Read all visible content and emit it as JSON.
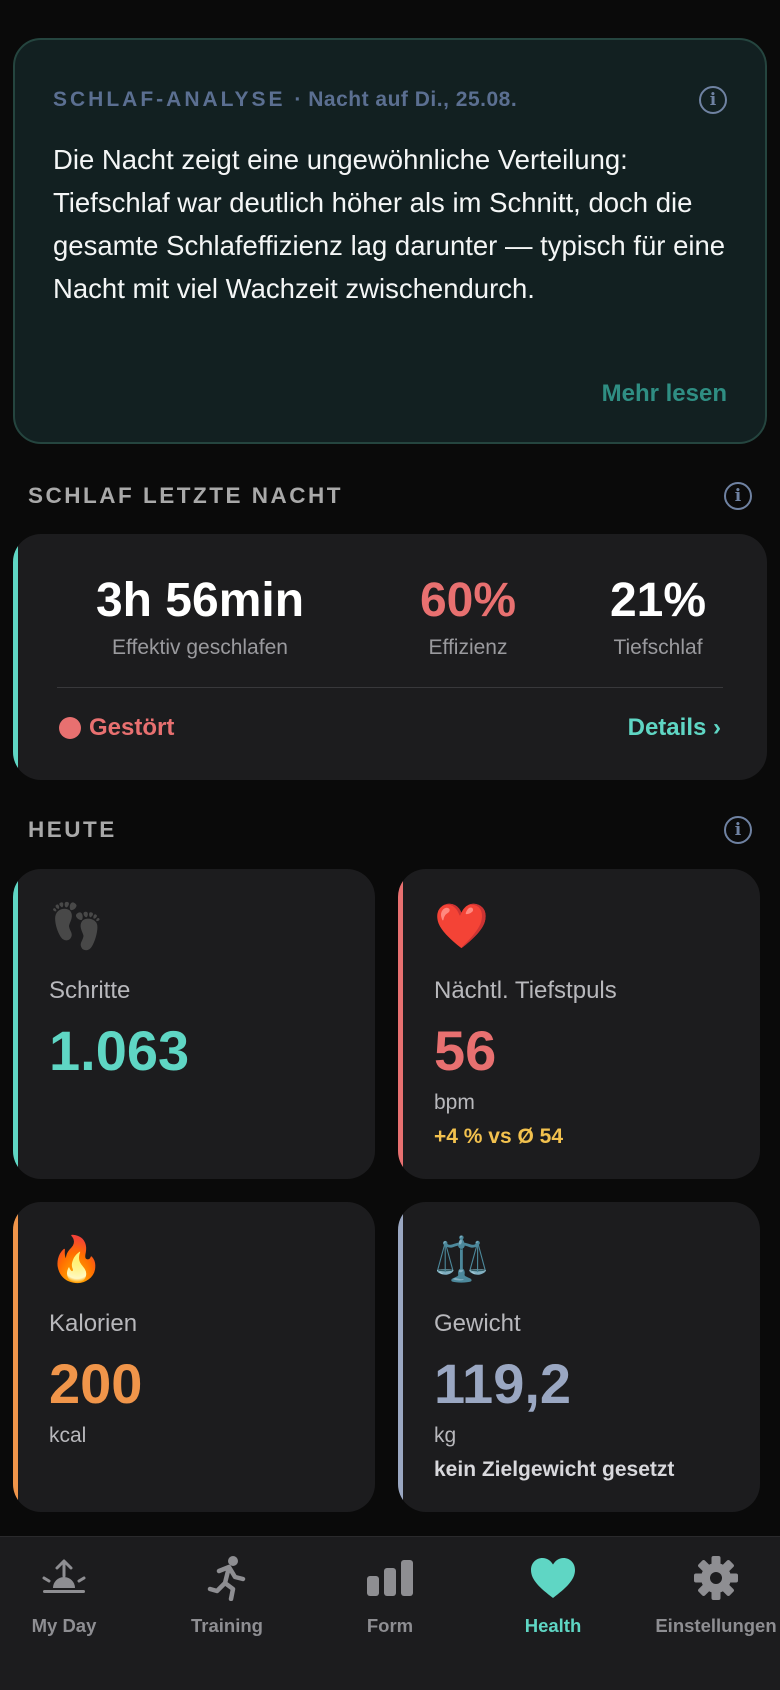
{
  "analysis": {
    "title": "SCHLAF-ANALYSE",
    "subtitle": "· Nacht auf Di., 25.08.",
    "text": "Die Nacht zeigt eine ungewöhnliche Verteilung: Tiefschlaf war deutlich höher als im Schnitt, doch die gesamte Schlafeffizienz lag darunter — typisch für eine Nacht mit viel Wachzeit zwischendurch.",
    "more_label": "Mehr lesen",
    "info_icon": "i"
  },
  "sleep": {
    "section_title": "SCHLAF LETZTE NACHT",
    "info_icon": "i",
    "stats": [
      {
        "value": "3h 56min",
        "label": "Effektiv geschlafen",
        "color": "#ffffff"
      },
      {
        "value": "60%",
        "label": "Effizienz",
        "color": "#e87070"
      },
      {
        "value": "21%",
        "label": "Tiefschlaf",
        "color": "#ffffff"
      }
    ],
    "status": "Gestört",
    "details_label": "Details ›",
    "accent": "#5fd6c4"
  },
  "today": {
    "section_title": "HEUTE",
    "info_icon": "i",
    "tiles": [
      {
        "icon": "footprints-icon",
        "glyph": "👣",
        "label": "Schritte",
        "value": "1.063",
        "color": "#5fd6c4"
      },
      {
        "icon": "heart-icon",
        "glyph": "❤️",
        "label": "Nächtl. Tiefstpuls",
        "value": "56",
        "unit": "bpm",
        "note": "+4 % vs Ø 54",
        "color": "#e87070",
        "note_color": "#f2c14e"
      },
      {
        "icon": "fire-icon",
        "glyph": "🔥",
        "label": "Kalorien",
        "value": "200",
        "unit": "kcal",
        "color": "#f0954a"
      },
      {
        "icon": "scales-icon",
        "glyph": "⚖️",
        "label": "Gewicht",
        "value": "119,2",
        "unit": "kg",
        "note": "kein Zielgewicht gesetzt",
        "color": "#9aa7c2",
        "note_color": "#d8d8dc"
      }
    ]
  },
  "tabs": [
    {
      "label": "My Day",
      "icon": "sunrise-icon"
    },
    {
      "label": "Training",
      "icon": "runner-icon"
    },
    {
      "label": "Form",
      "icon": "bar-chart-icon"
    },
    {
      "label": "Health",
      "icon": "heart-icon",
      "active": true
    },
    {
      "label": "Einstellungen",
      "icon": "gear-icon"
    }
  ]
}
